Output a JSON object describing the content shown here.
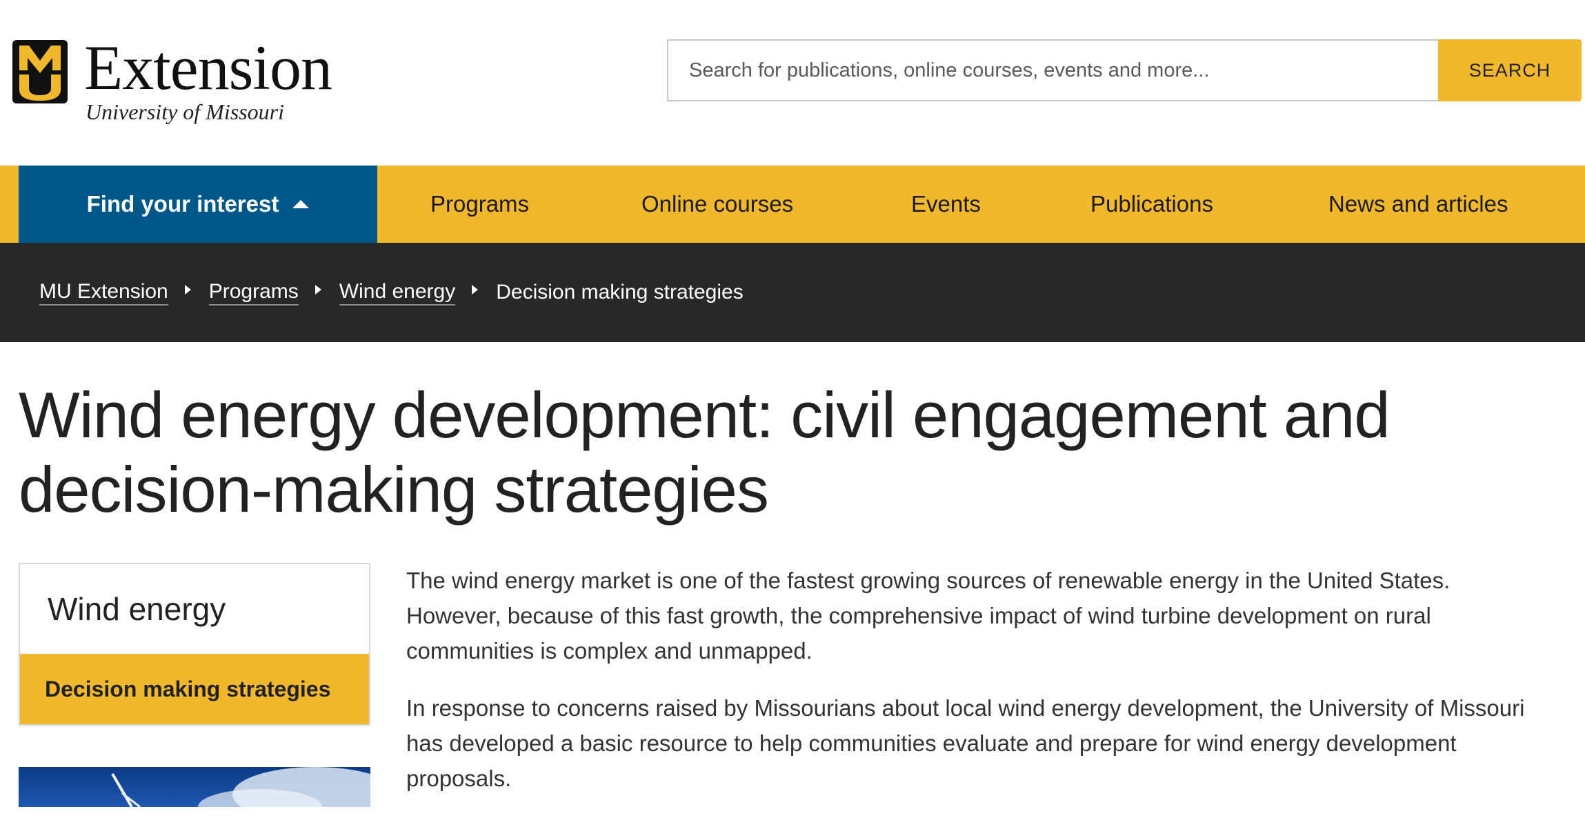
{
  "brand": {
    "wordmark": "Extension",
    "institution": "University of Missouri",
    "mark_letters": "MU",
    "colors": {
      "gold": "#f1b82d",
      "black": "#111111",
      "blue": "#00588a"
    }
  },
  "search": {
    "placeholder": "Search for publications, online courses, events and more...",
    "button_label": "SEARCH"
  },
  "nav": {
    "interest_label": "Find your interest",
    "items": [
      "Programs",
      "Online courses",
      "Events",
      "Publications",
      "News and articles"
    ]
  },
  "breadcrumb": {
    "links": [
      "MU Extension",
      "Programs",
      "Wind energy"
    ],
    "current": "Decision making strategies"
  },
  "page": {
    "title": "Wind energy development: civil engagement and decision-making strategies"
  },
  "sidebar": {
    "title": "Wind energy",
    "active_item": "Decision making strategies"
  },
  "content": {
    "paragraphs": [
      "The wind energy market is one of the fastest growing sources of renewable energy in the United States. However, because of this fast growth, the comprehensive impact of wind turbine development on rural communities is complex and unmapped.",
      "In response to concerns raised by Missourians about local wind energy development, the University of Missouri has developed a basic resource to help communities evaluate and prepare for wind energy development proposals."
    ]
  }
}
